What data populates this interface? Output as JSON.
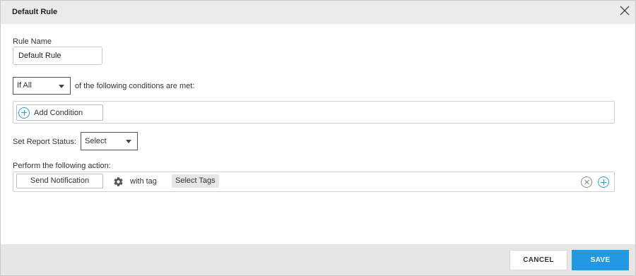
{
  "dialog": {
    "title": "Default Rule"
  },
  "rule_name": {
    "label": "Rule Name",
    "value": "Default Rule"
  },
  "conditions": {
    "match_select_value": "If All",
    "suffix_text": "of the following conditions are met:",
    "add_condition_label": "Add Condition"
  },
  "report_status": {
    "label": "Set Report Status:",
    "select_value": "Select"
  },
  "action": {
    "label": "Perform the following action:",
    "action_button_label": "Send Notification",
    "with_tag_text": "with tag",
    "tags_placeholder": "Select Tags"
  },
  "footer": {
    "cancel_label": "CANCEL",
    "save_label": "SAVE"
  },
  "colors": {
    "accent": "#2499e3",
    "plus_icon": "#29a1d6",
    "header_bg": "#ebebeb",
    "footer_bg": "#e6e6e6"
  },
  "icons": {
    "close": "close-icon",
    "add": "plus-circle-icon",
    "settings": "gear-icon",
    "remove": "x-circle-icon",
    "dropdown": "caret-down-icon"
  }
}
